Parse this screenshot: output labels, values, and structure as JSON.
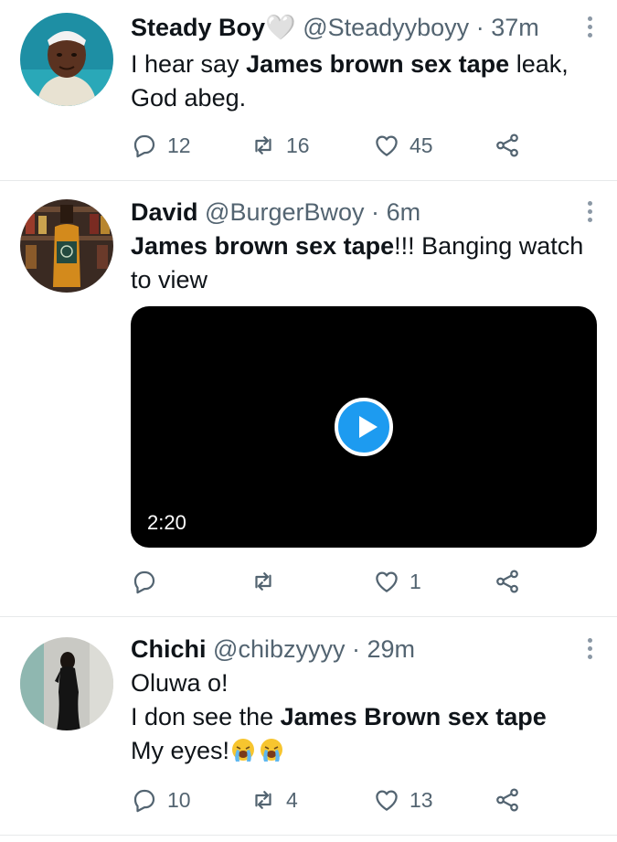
{
  "tweets": [
    {
      "name": "Steady Boy🤍",
      "handle": "@Steadyyboyy",
      "separator": "·",
      "time": "37m",
      "text_parts": [
        "I hear say ",
        "James brown sex tape",
        " leak,",
        "God abeg."
      ],
      "replies": "12",
      "retweets": "16",
      "likes": "45"
    },
    {
      "name": "David",
      "handle": "@BurgerBwoy",
      "separator": "·",
      "time": "6m",
      "text_parts": [
        "James brown sex tape",
        "!!! Banging watch",
        "to view"
      ],
      "video_duration": "2:20",
      "replies": "",
      "retweets": "",
      "likes": "1"
    },
    {
      "name": "Chichi",
      "handle": "@chibzyyyy",
      "separator": "·",
      "time": "29m",
      "text_parts": [
        "Oluwa o!",
        "I don see the ",
        "James Brown sex tape",
        "My eyes!"
      ],
      "replies": "10",
      "retweets": "4",
      "likes": "13"
    }
  ],
  "icons": {
    "reply": "reply-icon",
    "retweet": "retweet-icon",
    "like": "like-icon",
    "share": "share-icon",
    "more": "more-options-icon",
    "play": "play-icon",
    "emoji": "loudly-crying-face-emoji"
  },
  "colors": {
    "text": "#0f1419",
    "meta": "#536471",
    "accent": "#1d9bf0",
    "divider": "#e7e9ea"
  }
}
